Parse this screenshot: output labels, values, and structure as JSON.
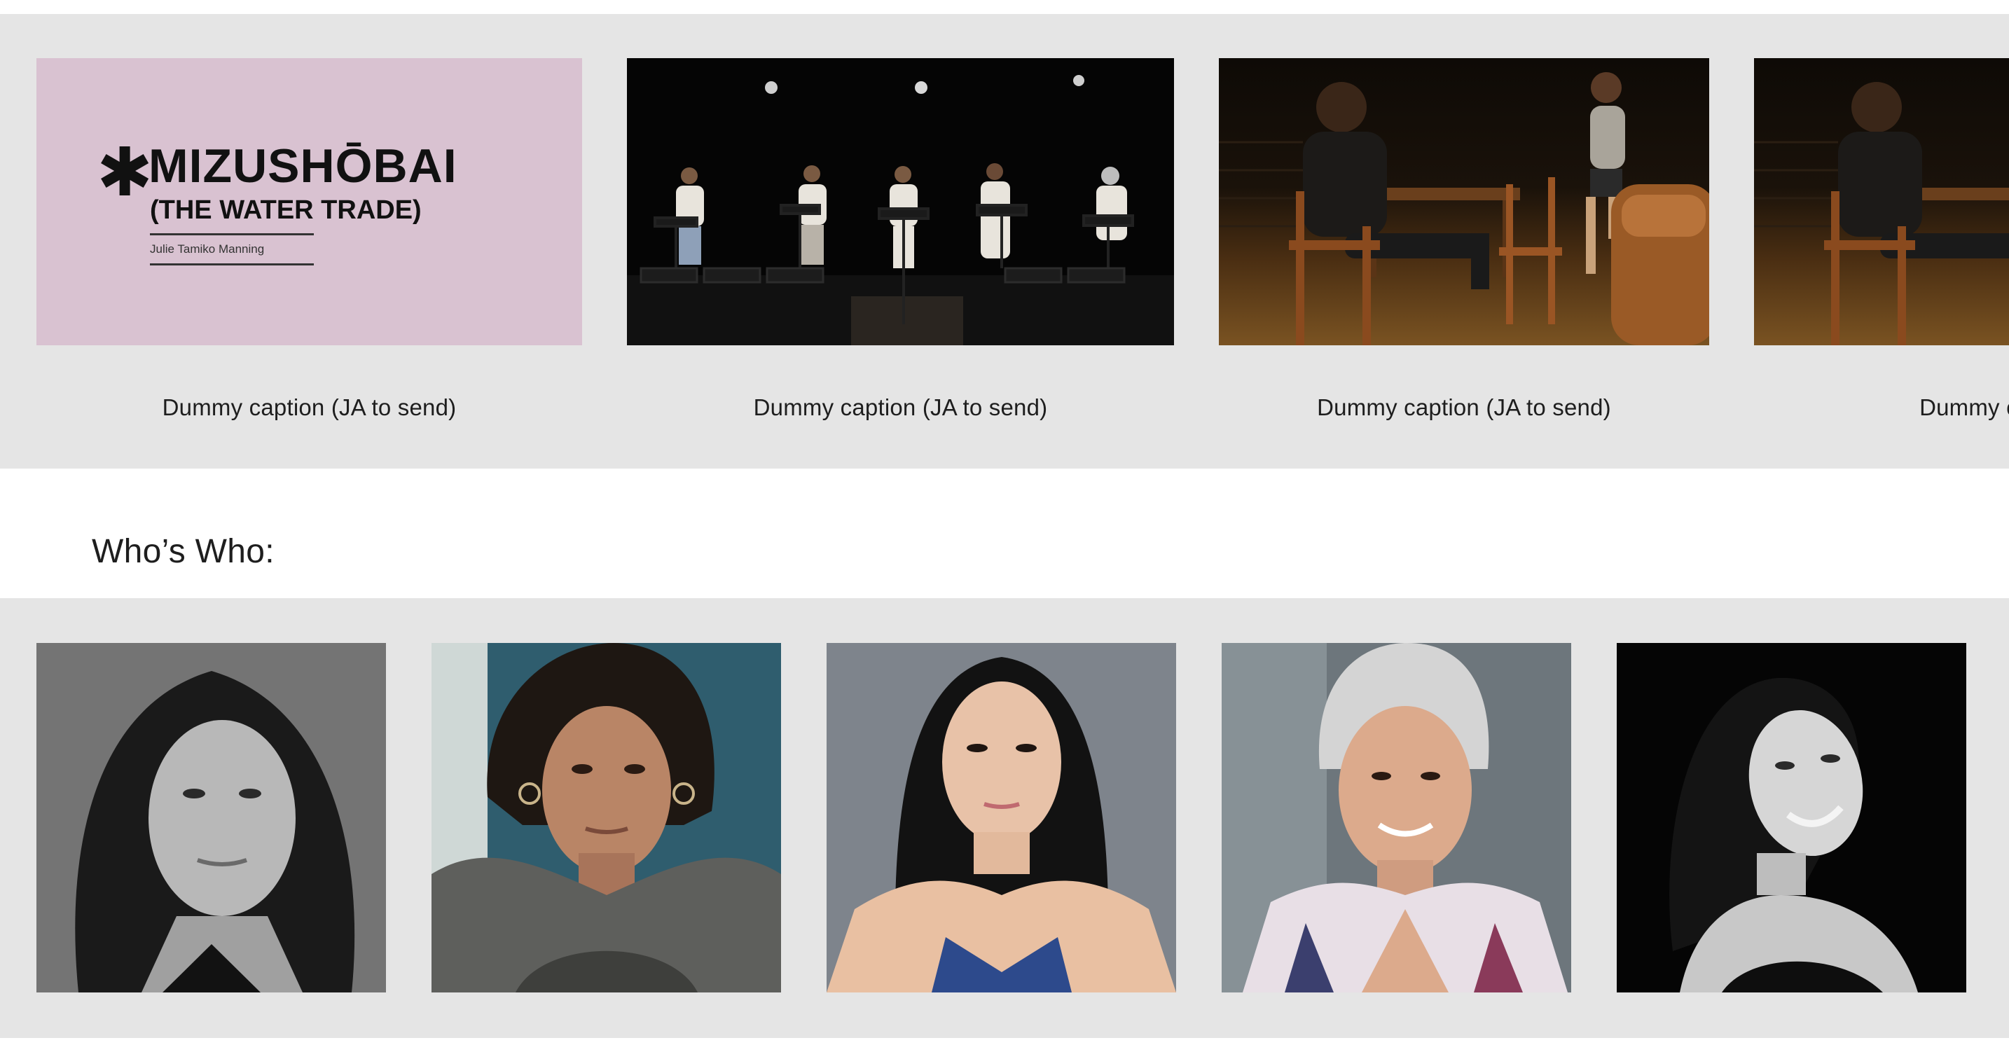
{
  "gallery": {
    "slides": [
      {
        "kind": "poster",
        "caption": "Dummy caption (JA to send)",
        "poster": {
          "mark": "✱",
          "title": "MIZUSHŌBAI",
          "subtitle": "(THE WATER TRADE)",
          "author": "Julie Tamiko Manning",
          "background": "#d9c2d1"
        }
      },
      {
        "kind": "stage-reading-photo",
        "caption": "Dummy caption (JA to send)"
      },
      {
        "kind": "theatre-scene-photo",
        "caption": "Dummy caption (JA to send)"
      },
      {
        "kind": "theatre-scene-photo",
        "caption": "Dummy caption"
      }
    ]
  },
  "whos_who": {
    "heading": "Who’s Who:",
    "headshots": [
      {
        "style": "black-and-white"
      },
      {
        "style": "color"
      },
      {
        "style": "color"
      },
      {
        "style": "color"
      },
      {
        "style": "black-and-white"
      }
    ]
  },
  "colors": {
    "section_background": "#e5e5e5",
    "page_background": "#ffffff",
    "text": "#1e1e1e"
  }
}
